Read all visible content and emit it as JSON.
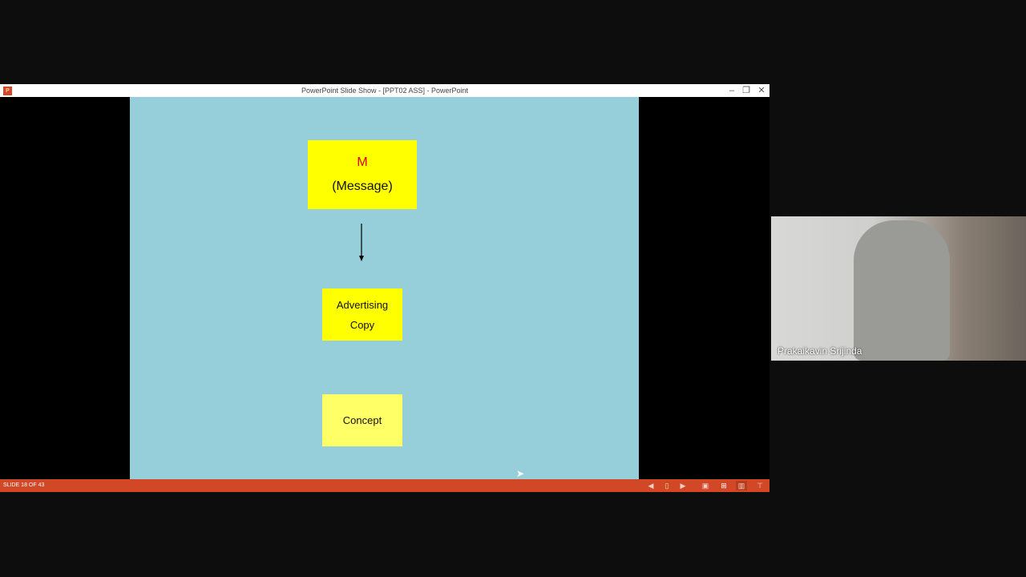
{
  "window": {
    "title": "PowerPoint Slide Show - [PPT02 ASS] - PowerPoint",
    "app_icon": "powerpoint-icon"
  },
  "slide": {
    "box1": {
      "letter": "M",
      "label": "(Message)",
      "letter_color": "#e00000",
      "fill": "#ffff00"
    },
    "box2": {
      "line1": "Advertising",
      "line2": "Copy",
      "fill": "#ffff00"
    },
    "box3": {
      "label": "Concept",
      "fill": "#ffff66"
    },
    "background": "#96ced9"
  },
  "statusbar": {
    "slide_counter": "SLIDE 18 OF 43",
    "accent": "#d24726"
  },
  "video": {
    "participant_name": "Prakaikavin Srijinda"
  }
}
